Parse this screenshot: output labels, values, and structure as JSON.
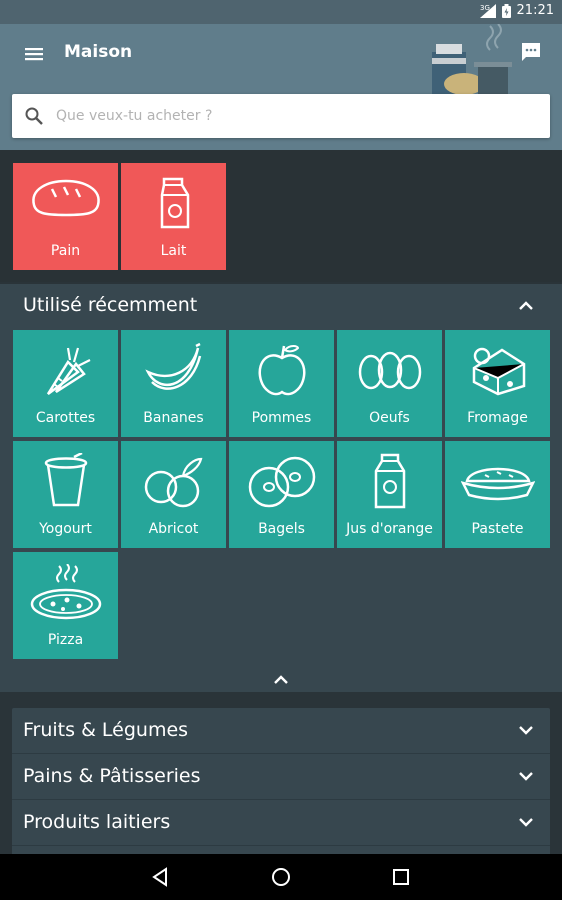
{
  "status": {
    "time": "21:21",
    "network": "3G"
  },
  "header": {
    "title": "Maison"
  },
  "search": {
    "placeholder": "Que veux-tu acheter ?"
  },
  "top_items": [
    {
      "label": "Pain",
      "icon": "bread-icon"
    },
    {
      "label": "Lait",
      "icon": "milk-carton-icon"
    }
  ],
  "recent": {
    "title": "Utilisé récemment",
    "items": [
      {
        "label": "Carottes",
        "icon": "carrot-icon"
      },
      {
        "label": "Bananes",
        "icon": "banana-icon"
      },
      {
        "label": "Pommes",
        "icon": "apple-icon"
      },
      {
        "label": "Oeufs",
        "icon": "eggs-icon"
      },
      {
        "label": "Fromage",
        "icon": "cheese-icon"
      },
      {
        "label": "Yogourt",
        "icon": "yogurt-icon"
      },
      {
        "label": "Abricot",
        "icon": "apricot-icon"
      },
      {
        "label": "Bagels",
        "icon": "bagel-icon"
      },
      {
        "label": "Jus d'orange",
        "icon": "juice-carton-icon"
      },
      {
        "label": "Pastete",
        "icon": "pie-icon"
      },
      {
        "label": "Pizza",
        "icon": "pizza-icon"
      }
    ]
  },
  "categories": [
    {
      "label": "Fruits & Légumes"
    },
    {
      "label": "Pains & Pâtisseries"
    },
    {
      "label": "Produits laitiers"
    }
  ],
  "colors": {
    "appbar": "#607d8b",
    "red_tile": "#f05858",
    "teal_tile": "#26a69a",
    "panel": "#37474f"
  }
}
